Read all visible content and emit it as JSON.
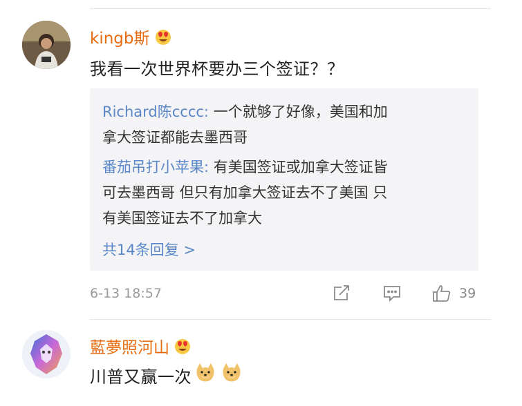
{
  "comments": [
    {
      "username": "kingb斯",
      "badge_icon": "heart-eyes-emoji-icon",
      "text": "我看一次世界杯要办三个签证？？",
      "replies": [
        {
          "user": "Richard陈cccc:",
          "text": " 一个就够了好像，美国和加",
          "text2": "拿大签证都能去墨西哥"
        },
        {
          "user": "番茄吊打小苹果:",
          "text": " 有美国签证或加拿大签证皆",
          "text2": "可去墨西哥 但只有加拿大签证去不了美国 只",
          "text3": "有美国签证去不了加拿大"
        }
      ],
      "more_replies": "共14条回复 >",
      "timestamp": "6-13 18:57",
      "like_count": "39"
    },
    {
      "username": "藍夢照河山",
      "badge_icon": "heart-eyes-emoji-icon",
      "text": "川普又赢一次",
      "emojis": [
        "doge-emoji-icon",
        "doge-emoji-icon"
      ]
    }
  ],
  "colors": {
    "username": "#e86b10",
    "reply_user": "#5a87c8",
    "reply_bg": "#f4f4f6",
    "meta": "#999999"
  }
}
